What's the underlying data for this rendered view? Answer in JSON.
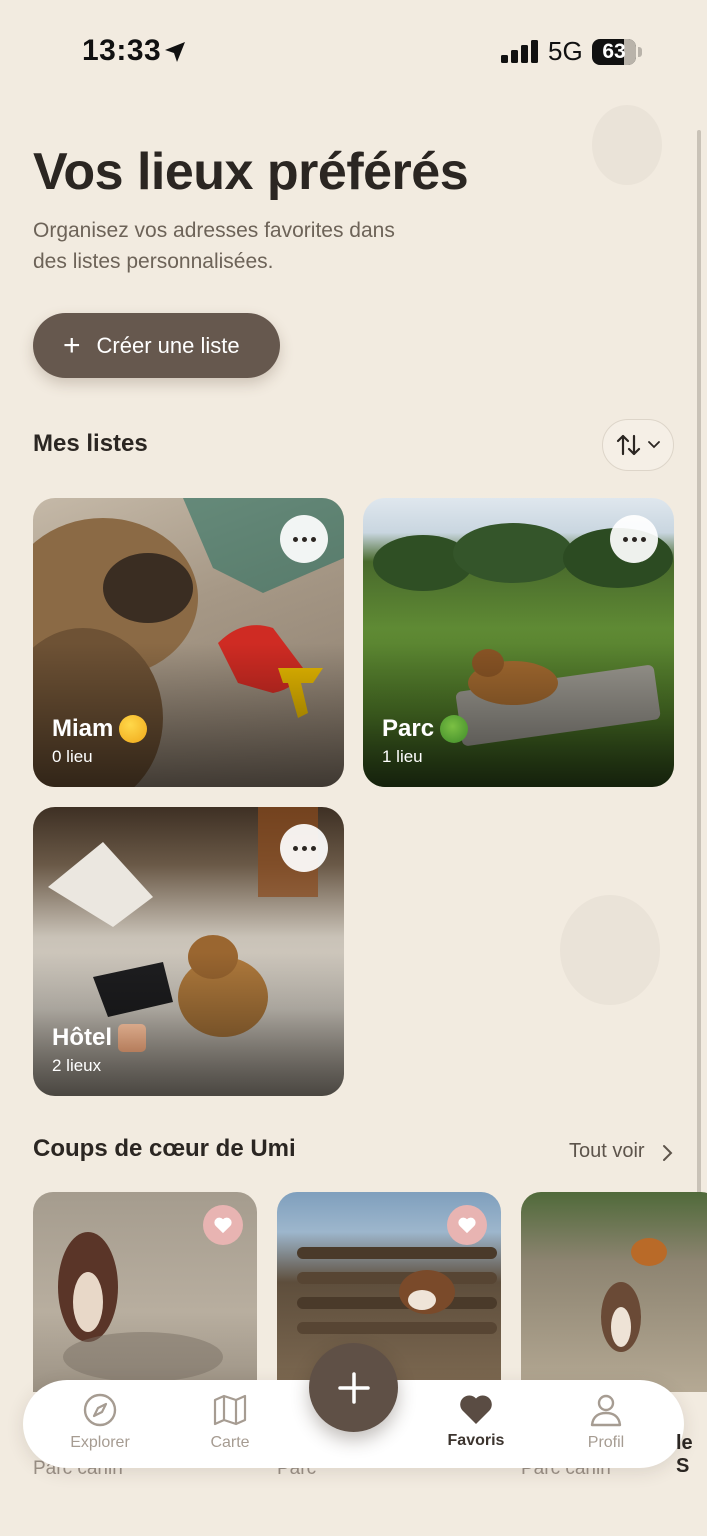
{
  "status_bar": {
    "time": "13:33",
    "network": "5G",
    "battery": "63"
  },
  "header": {
    "title": "Vos lieux préférés",
    "subtitle": "Organisez vos adresses favorites dans des listes personnalisées."
  },
  "create_button": {
    "label": "Créer une liste"
  },
  "lists_section": {
    "title": "Mes listes",
    "lists": [
      {
        "name": "Miam",
        "count": "0 lieu",
        "emoji": "yum-face-emoji"
      },
      {
        "name": "Parc",
        "count": "1 lieu",
        "emoji": "tree-emoji"
      },
      {
        "name": "Hôtel",
        "count": "2 lieux",
        "emoji": "handbag-emoji"
      }
    ]
  },
  "favorites_section": {
    "title": "Coups de cœur de Umi",
    "see_all": "Tout voir",
    "items": [
      {
        "caption": "Parc canin"
      },
      {
        "caption": "Parc"
      },
      {
        "caption": "Parc canin"
      }
    ],
    "peek_text": "le S"
  },
  "tab_bar": {
    "tabs": [
      {
        "label": "Explorer",
        "icon": "compass-icon"
      },
      {
        "label": "Carte",
        "icon": "map-icon"
      },
      {
        "label": "Favoris",
        "icon": "heart-icon",
        "active": true
      },
      {
        "label": "Profil",
        "icon": "person-icon"
      }
    ]
  },
  "colors": {
    "background": "#f2ebe0",
    "primary_button": "#66584e",
    "heart_badge": "#e8b4b2"
  }
}
